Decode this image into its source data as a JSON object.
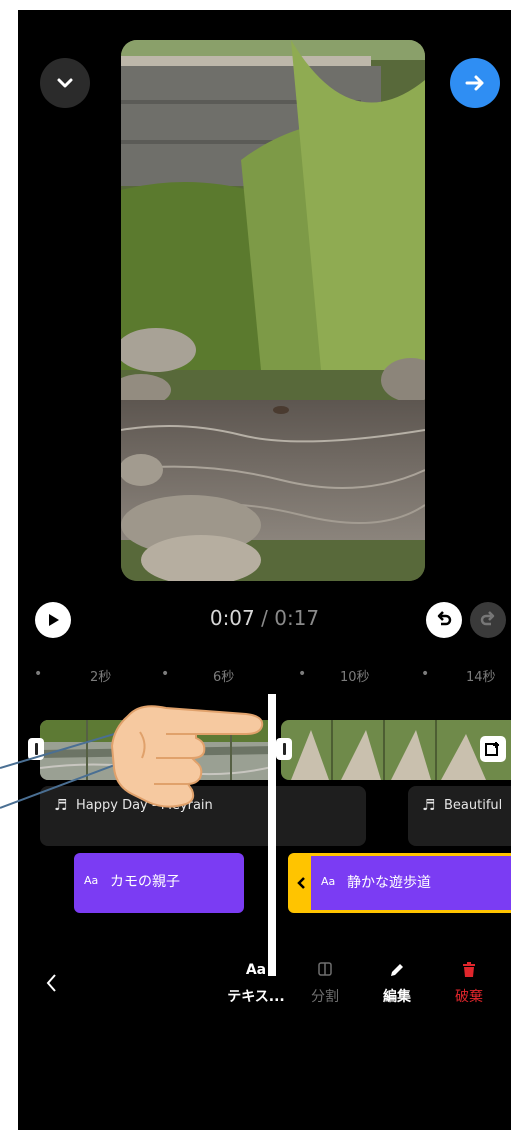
{
  "header": {
    "collapse_icon": "chevron-down-icon",
    "next_icon": "arrow-right-icon",
    "accent": "#2f8ef3"
  },
  "player": {
    "current_time": "0:07",
    "separator": " / ",
    "total_time": "0:17",
    "progress": 0.41
  },
  "ruler": {
    "labels": [
      "2秒",
      "6秒",
      "10秒",
      "14秒"
    ]
  },
  "timeline": {
    "audio_tracks": [
      {
        "label": "Happy Day - Meyrain"
      },
      {
        "label": "Beautiful"
      }
    ],
    "text_tracks": [
      {
        "icon": "Aa",
        "label": "カモの親子",
        "selected": false
      },
      {
        "icon": "Aa",
        "label": "静かな遊歩道",
        "selected": true
      }
    ],
    "text_color": "#7b3cf3",
    "selection_color": "#ffc400"
  },
  "toolbar": {
    "back_icon": "chevron-left-icon",
    "items": [
      {
        "icon": "Aa",
        "label": "テキス...",
        "enabled": true
      },
      {
        "icon": "split-icon",
        "label": "分割",
        "enabled": false
      },
      {
        "icon": "pencil-icon",
        "label": "編集",
        "enabled": true
      },
      {
        "icon": "trash-icon",
        "label": "破棄",
        "enabled": true
      }
    ],
    "delete_color": "#e0262c"
  }
}
